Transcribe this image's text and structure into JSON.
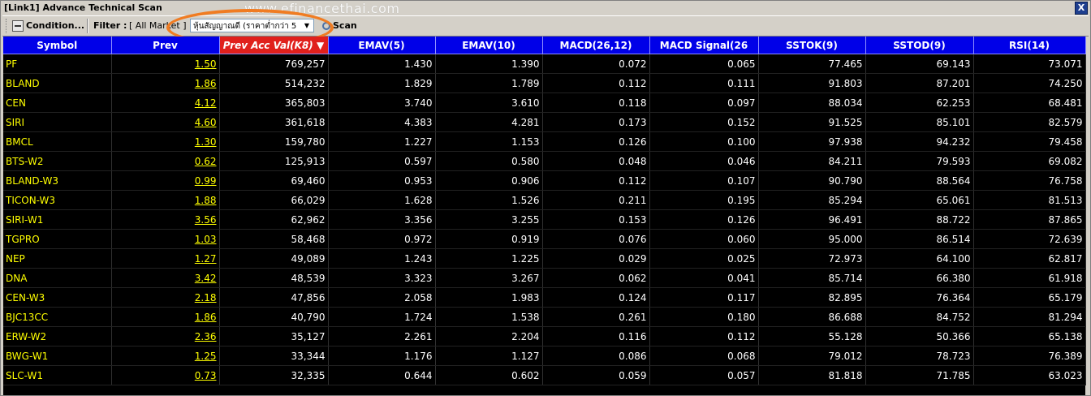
{
  "window": {
    "title": "[Link1] Advance Technical Scan",
    "close_label": "X",
    "watermark": "www.efinancethai.com"
  },
  "toolbar": {
    "condition_label": "Condition...",
    "filter_label": "Filter :",
    "filter_value": "[ All Market ]",
    "dropdown_value": "หุ้นสัญญาณดี (ราคาต่ำกว่า 5",
    "scan_label": "Scan"
  },
  "colors": {
    "header_bg": "#0000e8",
    "sorted_header_bg": "#e0201c",
    "symbol_text": "#ffff00",
    "grid_bg": "#000000",
    "highlight_ring": "#f07c22"
  },
  "table": {
    "columns": [
      "Symbol",
      "Prev",
      "Prev Acc Val(K8)",
      "EMAV(5)",
      "EMAV(10)",
      "MACD(26,12)",
      "MACD Signal(26",
      "SSTOK(9)",
      "SSTOD(9)",
      "RSI(14)"
    ],
    "sorted_column": "Prev Acc Val(K8)",
    "rows": [
      [
        "PF",
        "1.50",
        "769,257",
        "1.430",
        "1.390",
        "0.072",
        "0.065",
        "77.465",
        "69.143",
        "73.071"
      ],
      [
        "BLAND",
        "1.86",
        "514,232",
        "1.829",
        "1.789",
        "0.112",
        "0.111",
        "91.803",
        "87.201",
        "74.250"
      ],
      [
        "CEN",
        "4.12",
        "365,803",
        "3.740",
        "3.610",
        "0.118",
        "0.097",
        "88.034",
        "62.253",
        "68.481"
      ],
      [
        "SIRI",
        "4.60",
        "361,618",
        "4.383",
        "4.281",
        "0.173",
        "0.152",
        "91.525",
        "85.101",
        "82.579"
      ],
      [
        "BMCL",
        "1.30",
        "159,780",
        "1.227",
        "1.153",
        "0.126",
        "0.100",
        "97.938",
        "94.232",
        "79.458"
      ],
      [
        "BTS-W2",
        "0.62",
        "125,913",
        "0.597",
        "0.580",
        "0.048",
        "0.046",
        "84.211",
        "79.593",
        "69.082"
      ],
      [
        "BLAND-W3",
        "0.99",
        "69,460",
        "0.953",
        "0.906",
        "0.112",
        "0.107",
        "90.790",
        "88.564",
        "76.758"
      ],
      [
        "TICON-W3",
        "1.88",
        "66,029",
        "1.628",
        "1.526",
        "0.211",
        "0.195",
        "85.294",
        "65.061",
        "81.513"
      ],
      [
        "SIRI-W1",
        "3.56",
        "62,962",
        "3.356",
        "3.255",
        "0.153",
        "0.126",
        "96.491",
        "88.722",
        "87.865"
      ],
      [
        "TGPRO",
        "1.03",
        "58,468",
        "0.972",
        "0.919",
        "0.076",
        "0.060",
        "95.000",
        "86.514",
        "72.639"
      ],
      [
        "NEP",
        "1.27",
        "49,089",
        "1.243",
        "1.225",
        "0.029",
        "0.025",
        "72.973",
        "64.100",
        "62.817"
      ],
      [
        "DNA",
        "3.42",
        "48,539",
        "3.323",
        "3.267",
        "0.062",
        "0.041",
        "85.714",
        "66.380",
        "61.918"
      ],
      [
        "CEN-W3",
        "2.18",
        "47,856",
        "2.058",
        "1.983",
        "0.124",
        "0.117",
        "82.895",
        "76.364",
        "65.179"
      ],
      [
        "BJC13CC",
        "1.86",
        "40,790",
        "1.724",
        "1.538",
        "0.261",
        "0.180",
        "86.688",
        "84.752",
        "81.294"
      ],
      [
        "ERW-W2",
        "2.36",
        "35,127",
        "2.261",
        "2.204",
        "0.116",
        "0.112",
        "55.128",
        "50.366",
        "65.138"
      ],
      [
        "BWG-W1",
        "1.25",
        "33,344",
        "1.176",
        "1.127",
        "0.086",
        "0.068",
        "79.012",
        "78.723",
        "76.389"
      ],
      [
        "SLC-W1",
        "0.73",
        "32,335",
        "0.644",
        "0.602",
        "0.059",
        "0.057",
        "81.818",
        "71.785",
        "63.023"
      ]
    ]
  }
}
